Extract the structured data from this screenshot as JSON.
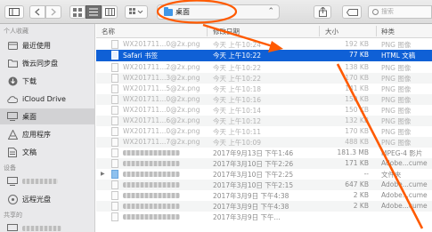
{
  "toolbar": {
    "location": "桌面",
    "search_placeholder": "搜索",
    "icons": [
      "sidebar-icon",
      "back-icon",
      "forward-icon",
      "list-view-icon",
      "column-view-icon",
      "gallery-view-icon",
      "action-gear-icon",
      "share-icon",
      "tag-icon"
    ]
  },
  "sidebar": {
    "favorites_header": "个人收藏",
    "favorites": [
      {
        "label": "最近使用",
        "icon": "recents-icon"
      },
      {
        "label": "微云同步盘",
        "icon": "folder-icon"
      },
      {
        "label": "下载",
        "icon": "download-icon"
      },
      {
        "label": "iCloud Drive",
        "icon": "cloud-icon"
      },
      {
        "label": "桌面",
        "icon": "desktop-icon",
        "selected": true
      },
      {
        "label": "应用程序",
        "icon": "applications-icon"
      },
      {
        "label": "文稿",
        "icon": "documents-icon"
      }
    ],
    "devices_header": "设备",
    "devices": [
      {
        "label": "远程光盘",
        "icon": "disc-icon"
      }
    ],
    "shared_header": "共享的"
  },
  "columns": {
    "name": "名称",
    "date": "修改日期",
    "size": "大小",
    "kind": "种类"
  },
  "files": [
    {
      "name": "WX201711...0@2x.png",
      "date": "今天 上午10:24",
      "size": "192 KB",
      "kind": "PNG 图像"
    },
    {
      "name": "Safari 书签",
      "date": "今天 上午10:22",
      "size": "77 KB",
      "kind": "HTML 文稿",
      "selected": true
    },
    {
      "name": "WX201711...2@2x.png",
      "date": "今天 上午10:22",
      "size": "138 KB",
      "kind": "PNG 图像"
    },
    {
      "name": "WX201711...3@2x.png",
      "date": "今天 上午10:22",
      "size": "170 KB",
      "kind": "PNG 图像"
    },
    {
      "name": "WX201711...5@2x.png",
      "date": "今天 上午10:18",
      "size": "141 KB",
      "kind": "PNG 图像"
    },
    {
      "name": "WX201711...0@2x.png",
      "date": "今天 上午10:16",
      "size": "150 KB",
      "kind": "PNG 图像"
    },
    {
      "name": "WX201711...0@2x.png",
      "date": "今天 上午10:14",
      "size": "150 KB",
      "kind": "PNG 图像"
    },
    {
      "name": "WX201711...6@2x.png",
      "date": "今天 上午10:12",
      "size": "132 KB",
      "kind": "PNG 图像"
    },
    {
      "name": "WX201711...0@2x.png",
      "date": "今天 上午10:11",
      "size": "170 KB",
      "kind": "PNG 图像"
    },
    {
      "name": "WX201711...7@2x.png",
      "date": "今天 上午10:09",
      "size": "488 KB",
      "kind": "PNG 图像"
    },
    {
      "name": "",
      "date": "2017年9月13日 下午1:46",
      "size": "181.3 MB",
      "kind": "MPEG-4 影片"
    },
    {
      "name": "",
      "date": "2017年3月10日 下午2:26",
      "size": "171 KB",
      "kind": "Adobe...cume"
    },
    {
      "name": "",
      "date": "2017年3月10日 下午2:25",
      "size": "--",
      "kind": "文件夹",
      "folder": true
    },
    {
      "name": "",
      "date": "2017年3月10日 下午2:15",
      "size": "647 KB",
      "kind": "Adobe...cume"
    },
    {
      "name": "",
      "date": "2017年3月9日 下午4:38",
      "size": "2 KB",
      "kind": "Adobe...cume"
    },
    {
      "name": "",
      "date": "2017年3月9日 下午4:38",
      "size": "2 KB",
      "kind": "Adobe...cume"
    },
    {
      "name": "",
      "date": "2017年3月9日 下午...",
      "size": "",
      "kind": ""
    }
  ],
  "colors": {
    "selection": "#0f60d6",
    "annotation": "#ff5a00",
    "folder": "#3f97e8"
  }
}
